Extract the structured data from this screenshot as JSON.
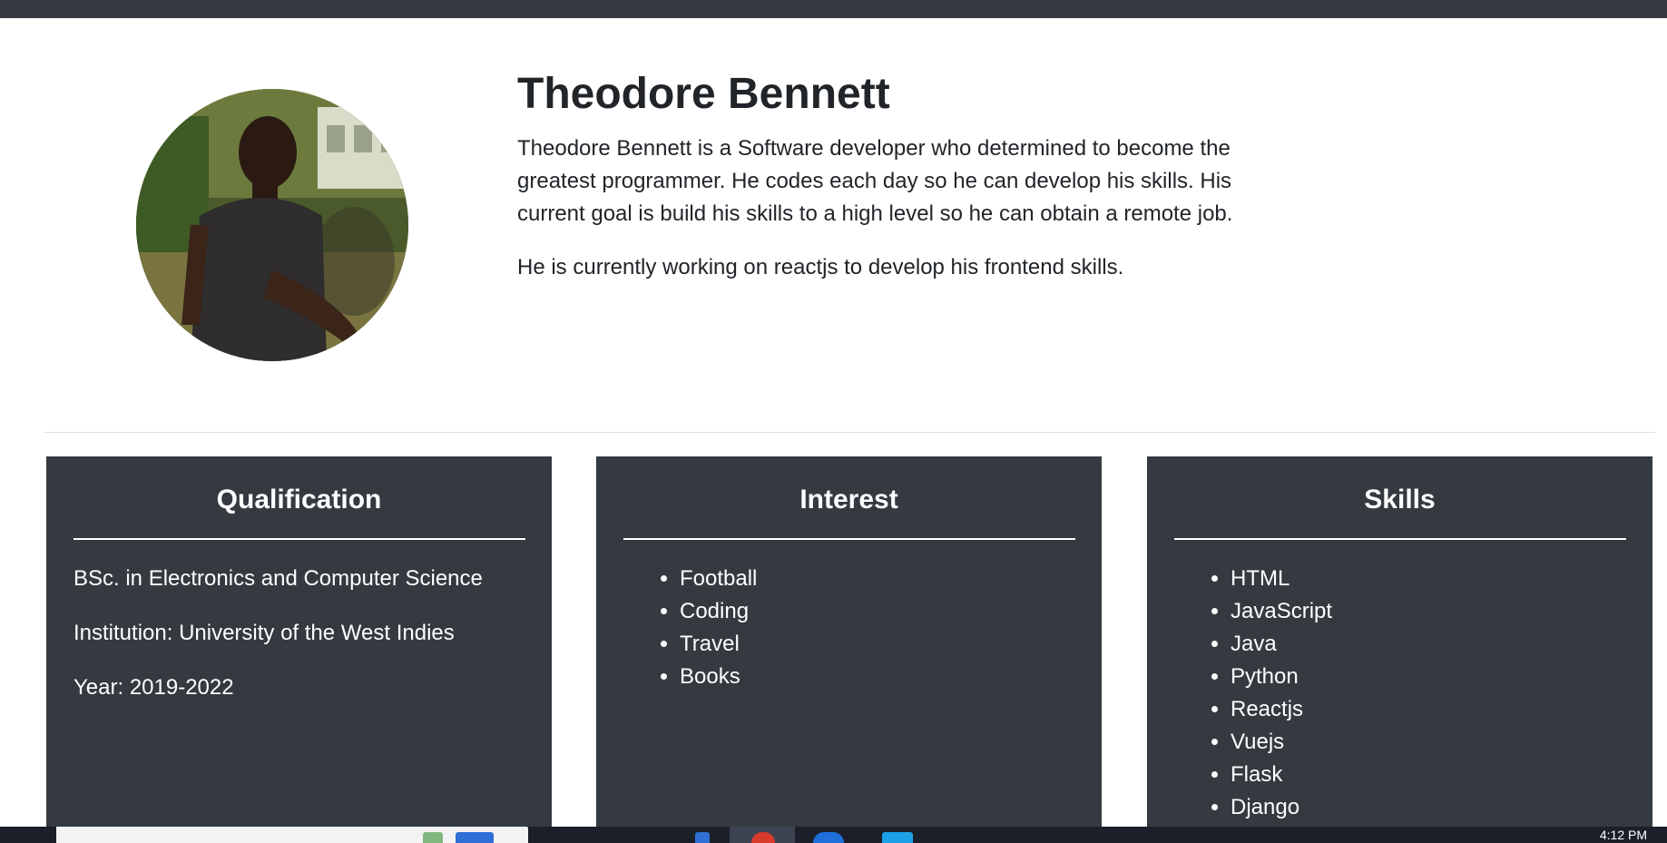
{
  "profile": {
    "name": "Theodore Bennett",
    "bio_paragraph_1": "Theodore Bennett is a Software developer who determined to become the greatest programmer. He codes each day so he can develop his skills. His current goal is build his skills to a high level so he can obtain a remote job.",
    "bio_paragraph_2": "He is currently working on reactjs to develop his frontend skills."
  },
  "cards": {
    "qualification": {
      "title": "Qualification",
      "degree": "BSc. in Electronics and Computer Science",
      "institution": "Institution: University of the West Indies",
      "year": "Year: 2019-2022"
    },
    "interest": {
      "title": "Interest",
      "items": [
        "Football",
        "Coding",
        "Travel",
        "Books"
      ]
    },
    "skills": {
      "title": "Skills",
      "items": [
        "HTML",
        "JavaScript",
        "Java",
        "Python",
        "Reactjs",
        "Vuejs",
        "Flask",
        "Django"
      ]
    }
  },
  "taskbar": {
    "clock": "4:12 PM"
  },
  "colors": {
    "dark": "#343a40",
    "text": "#212529",
    "white": "#ffffff"
  }
}
